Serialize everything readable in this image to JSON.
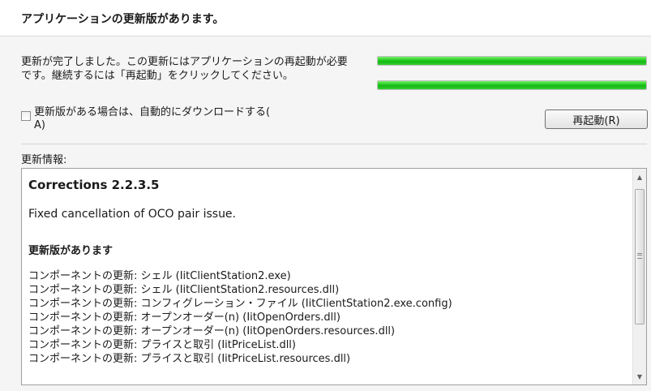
{
  "header": {
    "title": "アプリケーションの更新版があります。"
  },
  "message": {
    "line1": "更新が完了しました。この更新にはアプリケーションの再起動が必要",
    "line2": "です。継続するには「再起動」をクリックしてください。"
  },
  "progress_bars": [
    {
      "value": 1.0
    },
    {
      "value": 1.0
    }
  ],
  "auto_download": {
    "label_line1": "更新版がある場合は、自動的にダウンロードする(",
    "label_line2": "A)",
    "checked": false
  },
  "restart_button": {
    "label": "再起動(R)"
  },
  "update_info": {
    "label": "更新情報:",
    "version": "Corrections 2.2.3.5",
    "fix": "Fixed cancellation of OCO pair issue.",
    "updates_heading": "更新版があります",
    "items": [
      "コンポーネントの更新: シェル (IitClientStation2.exe)",
      "コンポーネントの更新: シェル (IitClientStation2.resources.dll)",
      "コンポーネントの更新: コンフィグレーション・ファイル (IitClientStation2.exe.config)",
      "コンポーネントの更新: オープンオーダー(n) (IitOpenOrders.dll)",
      "コンポーネントの更新: オープンオーダー(n) (IitOpenOrders.resources.dll)",
      "コンポーネントの更新: プライスと取引 (IitPriceList.dll)",
      "コンポーネントの更新: プライスと取引 (IitPriceList.resources.dll)"
    ]
  },
  "colors": {
    "progress_fill": "#1fc11c",
    "background": "#f5f5f5"
  },
  "icons": {
    "scroll_up": "triangle-up",
    "scroll_down": "triangle-down"
  }
}
